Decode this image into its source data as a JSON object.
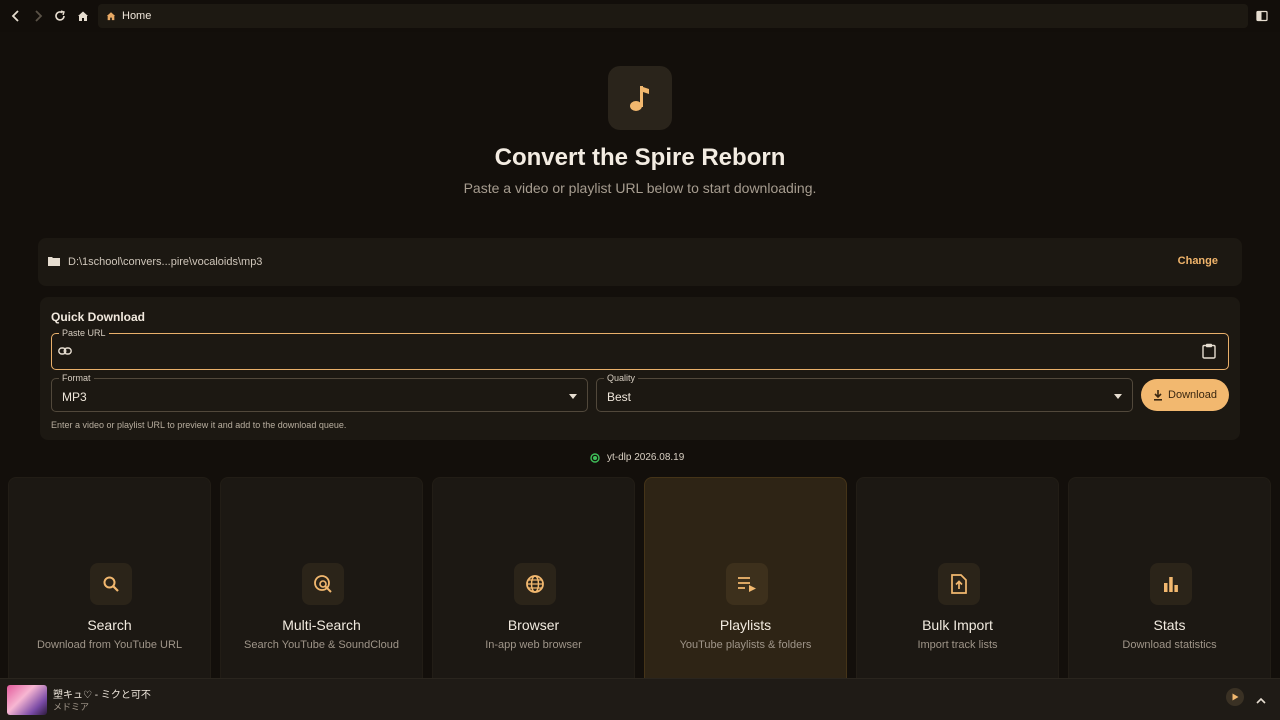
{
  "titlebar": {
    "address_text": "Home",
    "icons": [
      "back-icon",
      "forward-icon",
      "refresh-icon",
      "home-icon",
      "sidebar-toggle-icon"
    ]
  },
  "hero": {
    "icon": "music-note-icon",
    "title": "Convert the Spire Reborn",
    "subtitle": "Paste a video or playlist URL below to start downloading."
  },
  "folder": {
    "path": "D:\\1school\\convers...pire\\vocaloids\\mp3",
    "change_label": "Change"
  },
  "quick_download": {
    "title": "Quick Download",
    "url_label": "Paste URL",
    "url_value": "",
    "format_label": "Format",
    "format_value": "MP3",
    "quality_label": "Quality",
    "quality_value": "Best",
    "download_label": "Download",
    "hint": "Enter a video or playlist URL to preview it and add to the download queue."
  },
  "status": {
    "ytdlp_label": "yt-dlp 2026.08.19",
    "ytdlp_color": "#3fbf5a"
  },
  "cards": [
    {
      "title": "Search",
      "subtitle": "Download from YouTube URL",
      "icon": "search-icon",
      "active": false
    },
    {
      "title": "Multi-Search",
      "subtitle": "Search YouTube & SoundCloud",
      "icon": "multi-search-icon",
      "active": false
    },
    {
      "title": "Browser",
      "subtitle": "In-app web browser",
      "icon": "globe-icon",
      "active": false
    },
    {
      "title": "Playlists",
      "subtitle": "YouTube playlists & folders",
      "icon": "playlist-icon",
      "active": true
    },
    {
      "title": "Bulk Import",
      "subtitle": "Import track lists",
      "icon": "file-upload-icon",
      "active": false
    },
    {
      "title": "Stats",
      "subtitle": "Download statistics",
      "icon": "bar-chart-icon",
      "active": false
    }
  ],
  "player": {
    "title": "塑キュ♡ - ミクと可不",
    "artist": "メドミア"
  },
  "colors": {
    "accent": "#f2b86f",
    "background": "#130f0b",
    "panel": "#1c1812"
  }
}
